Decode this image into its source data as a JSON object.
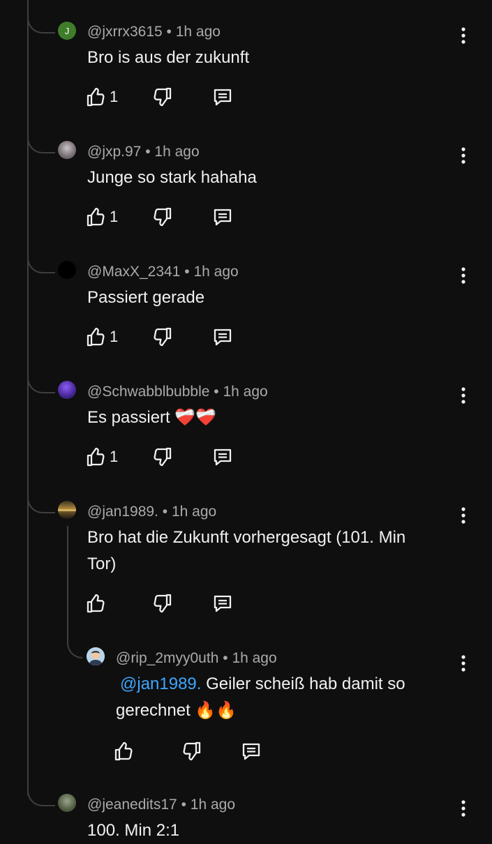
{
  "comments": [
    {
      "author": "@jxrrx3615",
      "separator": "•",
      "time": "1h ago",
      "avatar_initial": "J",
      "text": "Bro is aus der zukunft",
      "likes": "1"
    },
    {
      "author": "@jxp.97",
      "separator": "•",
      "time": "1h ago",
      "text": "Junge so stark hahaha",
      "likes": "1"
    },
    {
      "author": "@MaxX_2341",
      "separator": "•",
      "time": "1h ago",
      "text": "Passiert gerade",
      "likes": "1"
    },
    {
      "author": "@Schwabblbubble",
      "separator": "•",
      "time": "1h ago",
      "text": "Es passiert",
      "emoji": "❤️‍🩹❤️‍🩹",
      "likes": "1"
    },
    {
      "author": "@jan1989.",
      "separator": "•",
      "time": "1h ago",
      "text_line1": "Bro hat die Zukunft vorhergesagt (101. Min",
      "text_line2": "Tor)",
      "likes": ""
    },
    {
      "author": "@rip_2myy0uth",
      "separator": "•",
      "time": "1h ago",
      "mention": "@jan1989.",
      "text_line1": " Geiler scheiß hab damit so",
      "text_line2": "gerechnet",
      "emoji": "🔥🔥",
      "likes": ""
    },
    {
      "author": "@jeanedits17",
      "separator": "•",
      "time": "1h ago",
      "text": "100. Min 2:1"
    }
  ],
  "colors": {
    "background": "#0f0f0f",
    "text": "#f1f1f1",
    "meta": "#aaaaaa",
    "mention": "#3ea6ff",
    "thread_line": "#3f3f3f"
  },
  "icons": [
    "like-icon",
    "dislike-icon",
    "reply-icon",
    "more-options-icon"
  ]
}
